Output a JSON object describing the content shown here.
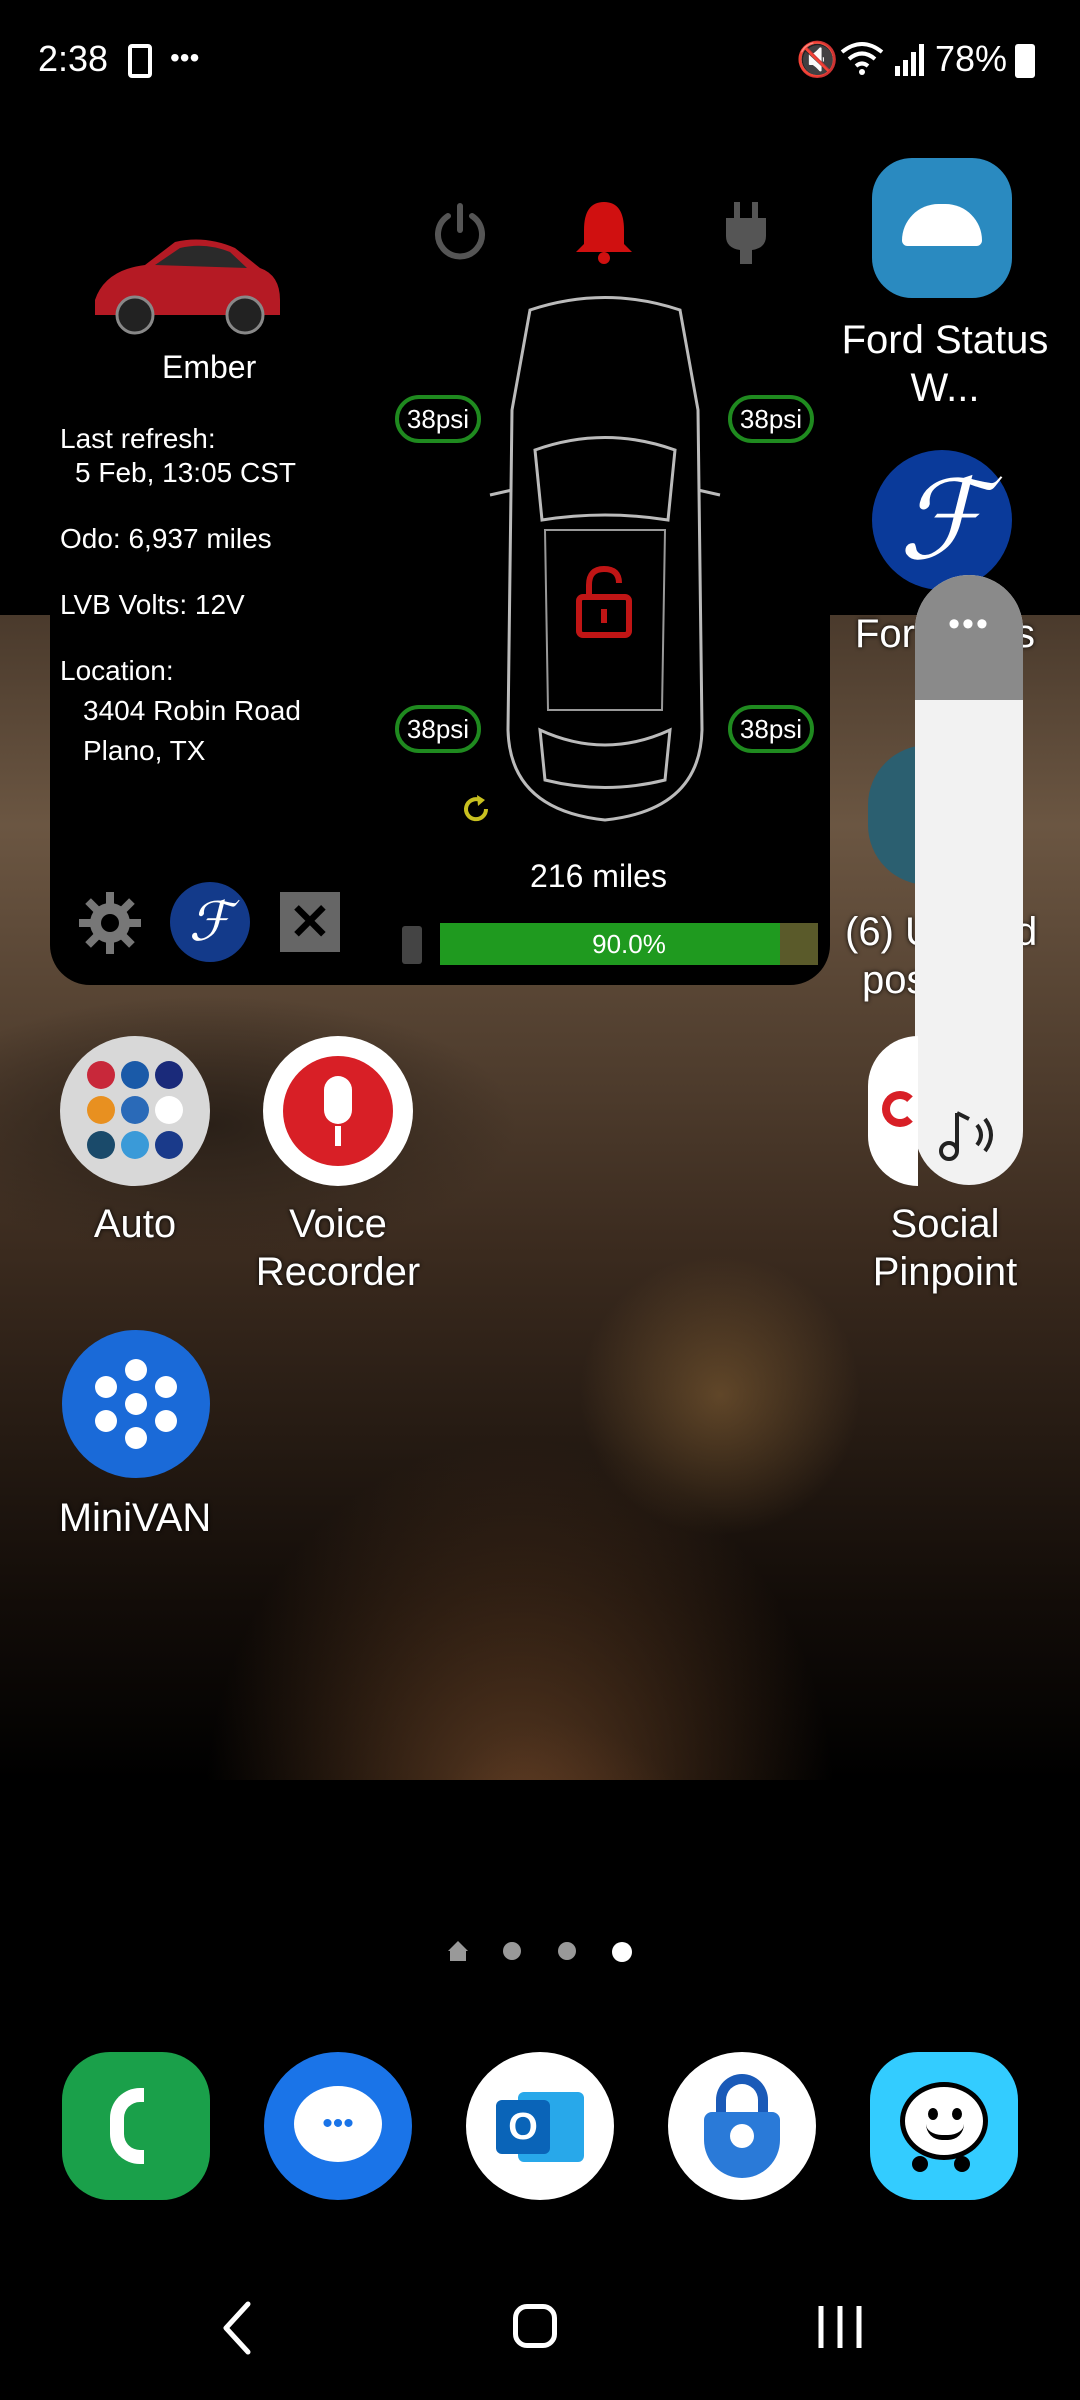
{
  "status_bar": {
    "time": "2:38",
    "battery": "78%",
    "icons": [
      "phone-screen-icon",
      "more-dots-icon",
      "mute-icon",
      "wifi-icon",
      "signal-icon",
      "battery-icon"
    ]
  },
  "widget": {
    "car_name": "Ember",
    "last_refresh_label": "Last refresh:",
    "last_refresh_value": "5 Feb, 13:05 CST",
    "odometer": "Odo: 6,937 miles",
    "lvb_volts": "LVB Volts: 12V",
    "location_label": "Location:",
    "location_line1": "3404 Robin Road",
    "location_line2": "Plano, TX",
    "tire_fl": "38psi",
    "tire_fr": "38psi",
    "tire_rl": "38psi",
    "tire_rr": "38psi",
    "range": "216 miles",
    "battery_percent_label": "90.0%",
    "battery_fraction": 0.9,
    "colors": {
      "tire_ok": "#1f8a1f",
      "alert": "#d01010",
      "battery_fill": "#1f9a1f"
    }
  },
  "apps": {
    "ford_status_widget": "Ford Status W...",
    "fordpass_partial": "For",
    "fordpass_partial_right": "s",
    "unread_partial_left": "(6) U",
    "unread_partial_right": "d",
    "unread_partial_line2": "pos",
    "auto": "Auto",
    "voice_recorder_line1": "Voice",
    "voice_recorder_line2": "Recorder",
    "social_pinpoint_line1": "Social",
    "social_pinpoint_line2": "Pinpoint",
    "minivan": "MiniVAN"
  },
  "page_indicator": {
    "pages": 4,
    "current": 4
  },
  "dock": [
    "phone-icon",
    "messages-icon",
    "outlook-icon",
    "authenticator-icon",
    "waze-icon"
  ],
  "nav": [
    "back-button",
    "home-button",
    "recents-button"
  ]
}
